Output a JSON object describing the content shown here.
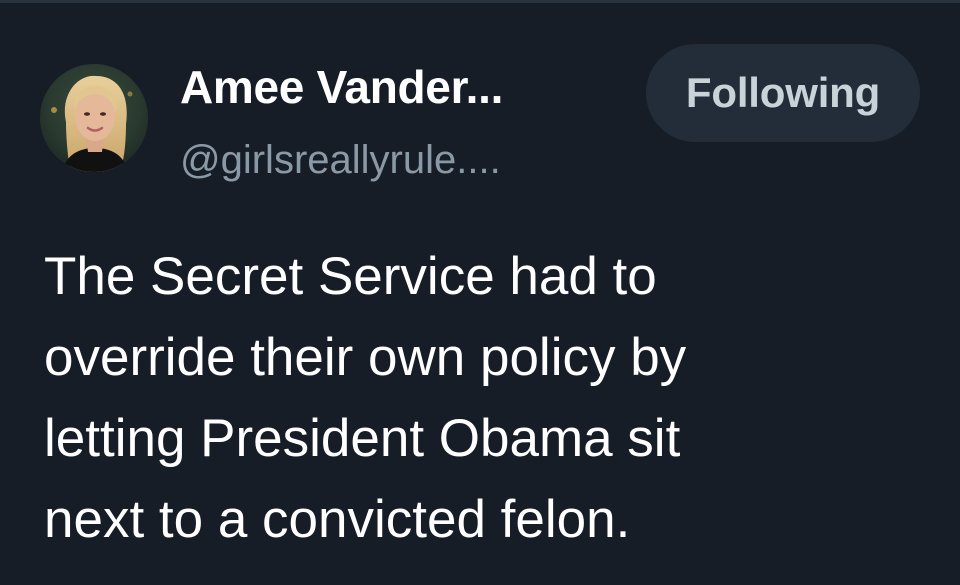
{
  "author": {
    "display_name": "Amee Vander...",
    "handle": "@girlsreallyrule....",
    "avatar_icon": "profile-photo"
  },
  "follow_button": {
    "label": "Following"
  },
  "tweet": {
    "lines": [
      "The Secret Service had to",
      "override their own policy by",
      "letting President Obama sit",
      "next to a convicted felon."
    ]
  },
  "colors": {
    "background": "#161d27",
    "name": "#ffffff",
    "handle": "#8b98a5",
    "button_bg": "#232d3a",
    "button_text": "#c9d1d9"
  }
}
